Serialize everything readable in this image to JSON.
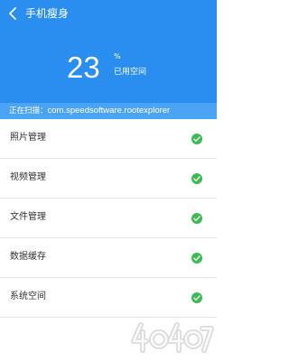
{
  "header": {
    "title": "手机瘦身",
    "back_icon": "chevron-left-icon",
    "bg_color": "#2a8ef0"
  },
  "usage": {
    "percent": "23",
    "percent_sign": "%",
    "label": "已用空间"
  },
  "scan": {
    "prefix": "正在扫描：",
    "target": "com.speedsoftware.rootexplorer"
  },
  "list": {
    "items": [
      {
        "label": "照片管理",
        "status_icon": "check-circle-icon"
      },
      {
        "label": "视频管理",
        "status_icon": "check-circle-icon"
      },
      {
        "label": "文件管理",
        "status_icon": "check-circle-icon"
      },
      {
        "label": "数据缓存",
        "status_icon": "check-circle-icon"
      },
      {
        "label": "系统空间",
        "status_icon": "check-circle-icon"
      }
    ],
    "check_color": "#3cba54"
  },
  "watermark": {
    "text": "4o4o7.com"
  }
}
